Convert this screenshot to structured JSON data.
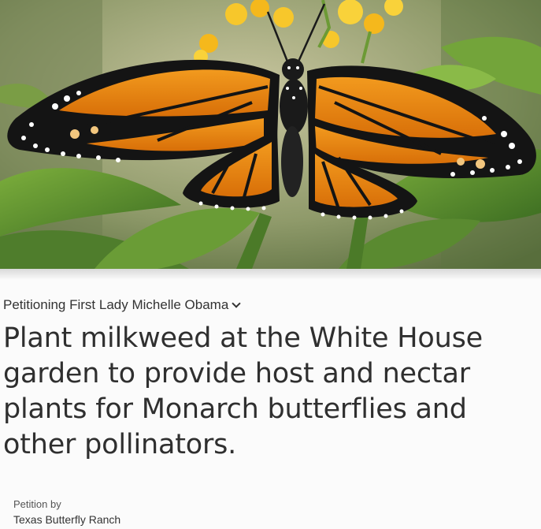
{
  "petition": {
    "target_label": "Petitioning First Lady Michelle Obama",
    "title": "Plant milkweed at the White House garden to provide host and nectar plants for Monarch butterflies and other pollinators.",
    "starter_label": "Petition by",
    "starter_name": "Texas Butterfly Ranch"
  },
  "icons": {
    "target_dropdown": "chevron-down-icon"
  },
  "colors": {
    "heading_text": "#2f2f2f",
    "body_text": "#333333",
    "page_background": "#fbfbfb",
    "monarch_orange": "#e8860f"
  }
}
